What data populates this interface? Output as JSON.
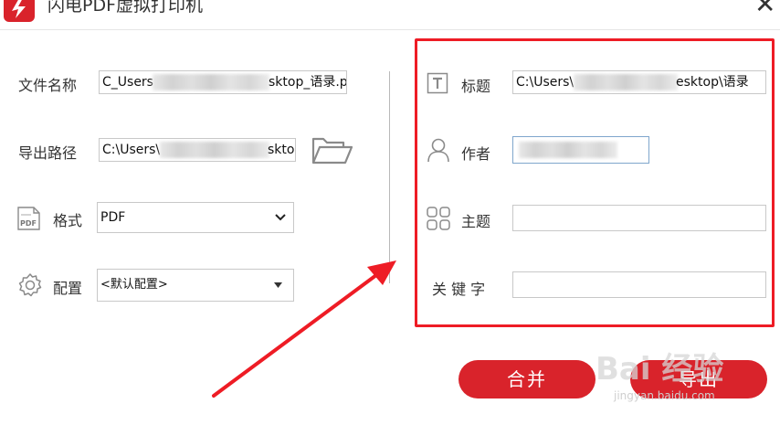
{
  "window": {
    "title": "闪电PDF虚拟打印机",
    "close_glyph": "✕"
  },
  "left": {
    "filename": {
      "label": "文件名称",
      "value_start": "C_Users",
      "value_end": "sktop_语录.p"
    },
    "export_path": {
      "label": "导出路径",
      "value_start": "C:\\Users\\",
      "value_end": "skto"
    },
    "format": {
      "label": "格式",
      "value": "PDF",
      "icon_text": "PDF"
    },
    "config": {
      "label": "配置",
      "value": "<默认配置>"
    }
  },
  "right": {
    "title_field": {
      "label": "标题",
      "value_start": "C:\\Users\\",
      "value_end": "esktop\\语录"
    },
    "author": {
      "label": "作者",
      "value": ""
    },
    "subject": {
      "label": "主题",
      "value": ""
    },
    "keywords": {
      "label": "关 键 字",
      "value": ""
    }
  },
  "buttons": {
    "merge": "合并",
    "export": "导出"
  },
  "watermark": {
    "brand": "Bai 经验",
    "url": "jingyan.baidu.com"
  },
  "colors": {
    "accent": "#d9232b",
    "highlight_box": "#ee1c25",
    "annotation_arrow": "#ee1c25"
  }
}
